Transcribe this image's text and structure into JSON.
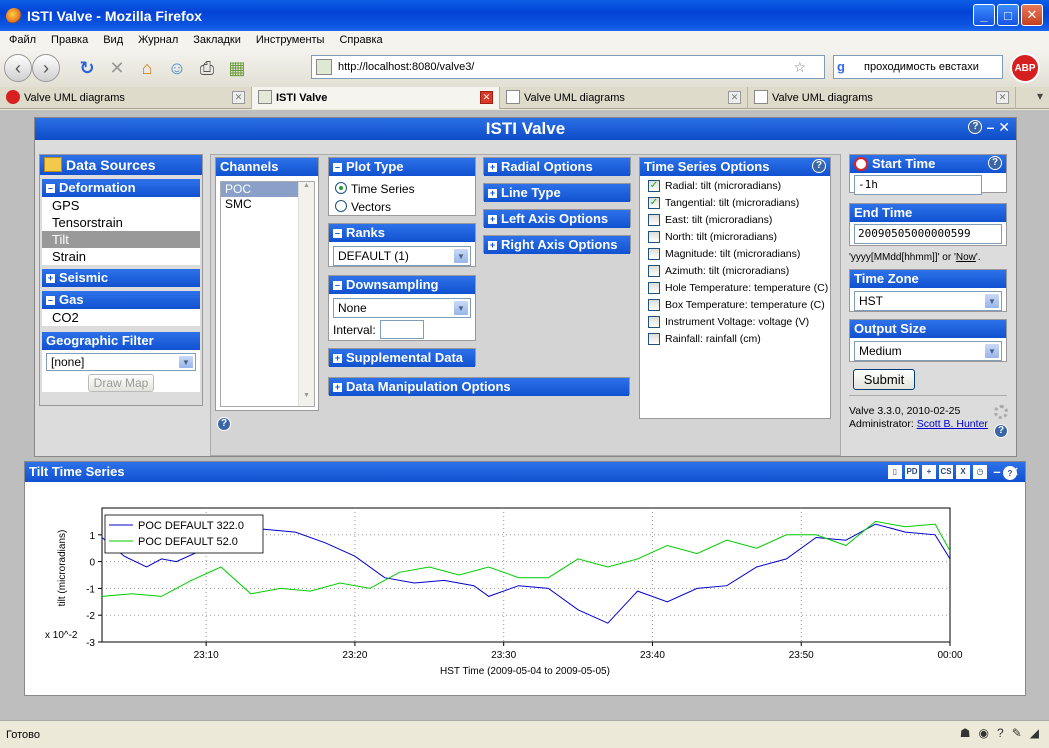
{
  "window": {
    "title": "ISTI Valve - Mozilla Firefox",
    "min": "_",
    "max": "□",
    "close": "✕"
  },
  "menu": [
    "Файл",
    "Правка",
    "Вид",
    "Журнал",
    "Закладки",
    "Инструменты",
    "Справка"
  ],
  "toolbar": {
    "url": "http://localhost:8080/valve3/",
    "search": "проходимость евстахи",
    "abp": "ABP"
  },
  "tabs": [
    {
      "label": "Valve UML diagrams",
      "active": false
    },
    {
      "label": "ISTI Valve",
      "active": true
    },
    {
      "label": "Valve UML diagrams",
      "active": false
    },
    {
      "label": "Valve UML diagrams",
      "active": false
    }
  ],
  "status": {
    "text": "Готово"
  },
  "app": {
    "title": "ISTI Valve",
    "help": "?",
    "minimize": "–",
    "close": "✕"
  },
  "data_sources": {
    "title": "Data Sources",
    "deformation": {
      "label": "Deformation",
      "items": [
        "GPS",
        "Tensorstrain",
        "Tilt",
        "Strain"
      ],
      "selected": "Tilt"
    },
    "seismic": {
      "label": "Seismic"
    },
    "gas": {
      "label": "Gas",
      "items": [
        "CO2"
      ]
    },
    "geo_filter": {
      "label": "Geographic Filter",
      "value": "[none]",
      "draw_map": "Draw Map"
    }
  },
  "channels": {
    "title": "Channels",
    "items": [
      "POC",
      "SMC"
    ],
    "selected": "POC"
  },
  "plot_type": {
    "title": "Plot Type",
    "options": [
      "Time Series",
      "Vectors"
    ],
    "selected": "Time Series"
  },
  "ranks": {
    "title": "Ranks",
    "value": "DEFAULT (1)"
  },
  "downsampling": {
    "title": "Downsampling",
    "value": "None",
    "interval_label": "Interval:"
  },
  "supplemental": {
    "title": "Supplemental Data"
  },
  "data_manipulation": {
    "title": "Data Manipulation Options"
  },
  "radial_options": {
    "title": "Radial Options"
  },
  "line_type": {
    "title": "Line Type"
  },
  "left_axis": {
    "title": "Left Axis Options"
  },
  "right_axis": {
    "title": "Right Axis Options"
  },
  "ts_options": {
    "title": "Time Series Options",
    "items": [
      {
        "label": "Radial: tilt (microradians)",
        "checked": true
      },
      {
        "label": "Tangential: tilt (microradians)",
        "checked": true
      },
      {
        "label": "East: tilt (microradians)",
        "checked": false
      },
      {
        "label": "North: tilt (microradians)",
        "checked": false
      },
      {
        "label": "Magnitude: tilt (microradians)",
        "checked": false
      },
      {
        "label": "Azimuth: tilt (microradians)",
        "checked": false
      },
      {
        "label": "Hole Temperature: temperature (C)",
        "checked": false
      },
      {
        "label": "Box Temperature: temperature (C)",
        "checked": false
      },
      {
        "label": "Instrument Voltage: voltage (V)",
        "checked": false
      },
      {
        "label": "Rainfall: rainfall (cm)",
        "checked": false
      }
    ]
  },
  "time": {
    "start_title": "Start Time",
    "start_value": "-1h",
    "end_title": "End Time",
    "end_value": "20090505000000599",
    "format_hint_prefix": "'yyyy[MMdd[hhmm]]' or '",
    "format_hint_link": "Now",
    "format_hint_suffix": "'.",
    "zone_title": "Time Zone",
    "zone_value": "HST",
    "size_title": "Output Size",
    "size_value": "Medium",
    "submit": "Submit"
  },
  "version": {
    "text": "Valve 3.3.0, 2010-02-25",
    "admin_label": "Administrator:",
    "admin_name": "Scott B. Hunter"
  },
  "chart_data": {
    "panel_title": "Tilt Time Series",
    "type": "line",
    "ylabel": "tilt (microradians)",
    "y_multiplier": "x 10^-2",
    "xlabel": "HST Time (2009-05-04 to 2009-05-05)",
    "ylim": [
      -3,
      2
    ],
    "yticks": [
      "-3",
      "-2",
      "-1",
      "0",
      "1"
    ],
    "xticks": [
      "23:10",
      "23:20",
      "23:30",
      "23:40",
      "23:50",
      "00:00"
    ],
    "xlim_minutes": [
      -57,
      0
    ],
    "grid": true,
    "legend_position": "top-left",
    "series": [
      {
        "name": "POC DEFAULT 322.0",
        "color": "#0000cc",
        "x": [
          -57,
          -55.5,
          -54,
          -53,
          -52,
          -50,
          -48,
          -46,
          -44,
          -42,
          -40,
          -38,
          -36,
          -34,
          -32,
          -31,
          -29,
          -27,
          -25,
          -23,
          -21,
          -19,
          -17,
          -15,
          -13,
          -11,
          -9,
          -7,
          -5,
          -3,
          -1,
          0
        ],
        "y": [
          0.9,
          0.2,
          -0.2,
          0.1,
          0.0,
          0.5,
          1.3,
          1.2,
          1.1,
          0.7,
          0.2,
          -0.6,
          -0.8,
          -0.7,
          -0.9,
          -1.3,
          -0.9,
          -1.0,
          -1.8,
          -2.3,
          -1.1,
          -1.5,
          -1.0,
          -0.9,
          -0.2,
          0.1,
          0.9,
          0.8,
          1.4,
          1.1,
          1.0,
          0.1
        ]
      },
      {
        "name": "POC DEFAULT 52.0",
        "color": "#00cc00",
        "x": [
          -57,
          -55,
          -53,
          -51,
          -49,
          -47,
          -45,
          -43,
          -41,
          -39,
          -37,
          -35,
          -33,
          -31,
          -29,
          -27,
          -25,
          -23,
          -21,
          -19,
          -17,
          -15,
          -13,
          -11,
          -9,
          -7,
          -5,
          -3,
          -1,
          0
        ],
        "y": [
          -1.3,
          -1.2,
          -1.3,
          -0.7,
          -0.2,
          -1.2,
          -1.0,
          -1.1,
          -0.8,
          -1.0,
          -0.4,
          -0.2,
          -0.5,
          -0.2,
          -0.6,
          -0.6,
          0.1,
          -0.2,
          0.1,
          0.6,
          0.3,
          0.8,
          0.5,
          1.0,
          1.0,
          0.6,
          1.5,
          1.3,
          1.4,
          0.4
        ]
      }
    ]
  }
}
